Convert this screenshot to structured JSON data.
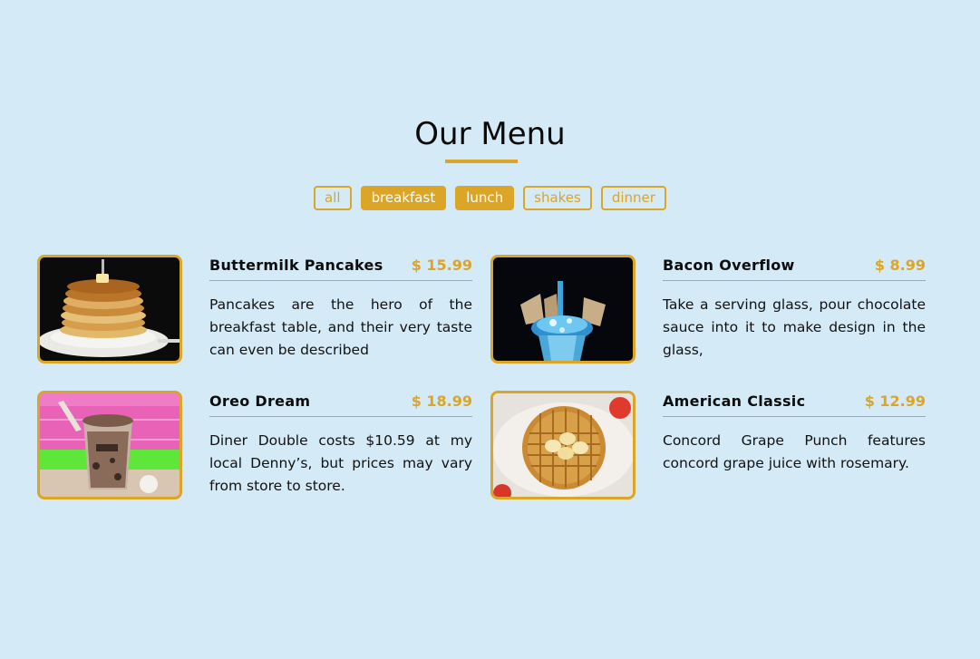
{
  "menu": {
    "title": "Our Menu",
    "filters": [
      {
        "label": "all",
        "active": false
      },
      {
        "label": "breakfast",
        "active": true
      },
      {
        "label": "lunch",
        "active": true
      },
      {
        "label": "shakes",
        "active": false
      },
      {
        "label": "dinner",
        "active": false
      }
    ],
    "items": [
      {
        "name": "Buttermilk Pancakes",
        "price": "$ 15.99",
        "description": "Pancakes are the hero of the breakfast table, and their very taste can even be described",
        "image_icon": "pancakes-image"
      },
      {
        "name": "Bacon Overflow",
        "price": "$ 8.99",
        "description": "Take a serving glass, pour chocolate sauce into it to make design in the glass,",
        "image_icon": "milkshake-image"
      },
      {
        "name": "Oreo Dream",
        "price": "$ 18.99",
        "description": "Diner Double costs $10.59 at my local Denny’s, but prices may vary from store to store.",
        "image_icon": "oreo-shake-image"
      },
      {
        "name": "American Classic",
        "price": "$ 12.99",
        "description": "Concord Grape Punch features concord grape juice with rosemary.",
        "image_icon": "waffle-image"
      }
    ]
  },
  "colors": {
    "background": "#d5eaf7",
    "accent": "#dba527",
    "text": "#0d0d0d"
  }
}
